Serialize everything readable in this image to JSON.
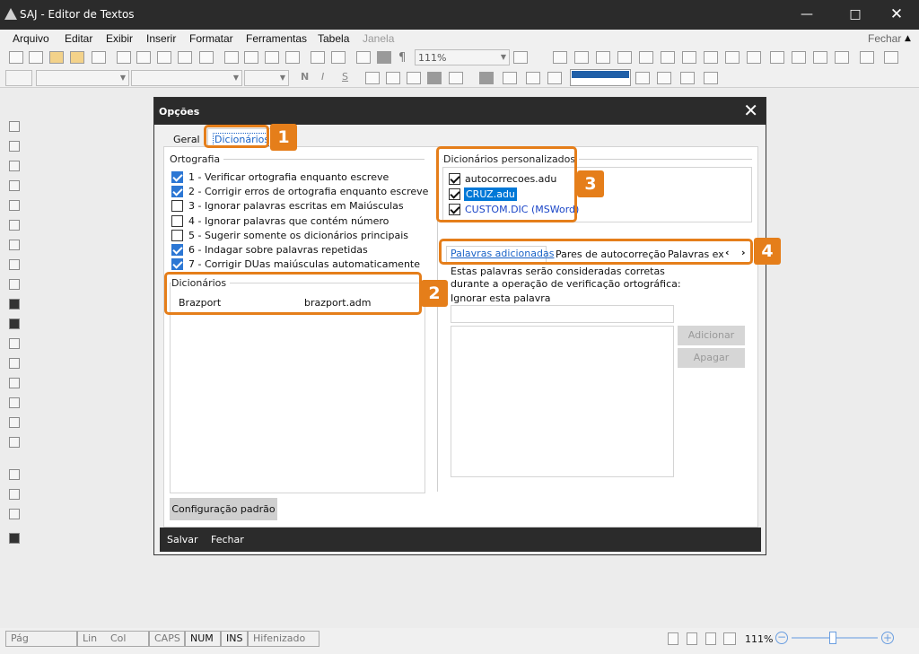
{
  "app": {
    "title": "SAJ - Editor de Textos"
  },
  "menu": {
    "items": [
      "Arquivo",
      "Editar",
      "Exibir",
      "Inserir",
      "Formatar",
      "Ferramentas",
      "Tabela",
      "Janela"
    ],
    "close_label": "Fechar"
  },
  "toolbar": {
    "zoom": "111%"
  },
  "dialog": {
    "title": "Opções",
    "tabs": [
      "Geral",
      "Dicionários"
    ],
    "ortografia": {
      "title": "Ortografia",
      "options": [
        {
          "label": "1 - Verificar ortografia enquanto escreve",
          "checked": true
        },
        {
          "label": "2 - Corrigir erros de ortografia enquanto escreve",
          "checked": true
        },
        {
          "label": "3 - Ignorar palavras escritas em Maiúsculas",
          "checked": false
        },
        {
          "label": "4 - Ignorar palavras que contém número",
          "checked": false
        },
        {
          "label": "5 - Sugerir somente os dicionários principais",
          "checked": false
        },
        {
          "label": "6 - Indagar sobre palavras repetidas",
          "checked": true
        },
        {
          "label": "7 - Corrigir DUas maiúsculas automaticamente",
          "checked": true
        }
      ]
    },
    "dicionarios": {
      "title": "Dicionários",
      "rows": [
        {
          "name": "Brazport",
          "file": "brazport.adm"
        }
      ]
    },
    "personalizados": {
      "title": "Dicionários personalizados",
      "items": [
        {
          "label": "autocorrecoes.adu",
          "checked": true
        },
        {
          "label": "CRUZ.adu",
          "checked": true,
          "selected": true
        },
        {
          "label": "CUSTOM.DIC (MSWord)",
          "checked": true,
          "link": true
        }
      ]
    },
    "subtabs": [
      "Palavras adicionadas",
      "Pares de autocorreção",
      "Palavras exc"
    ],
    "description": "Estas palavras serão consideradas corretas durante a operação de verificação ortográfica:",
    "ignore_label": "Ignorar esta palavra",
    "add_button": "Adicionar",
    "remove_button": "Apagar",
    "default_button": "Configuração padrão",
    "save_button": "Salvar",
    "close_button": "Fechar"
  },
  "callouts": [
    "1",
    "2",
    "3",
    "4"
  ],
  "statusbar": {
    "items": [
      "Pág",
      "Lin",
      "Col",
      "CAPS",
      "NUM",
      "INS",
      "Hifenizado"
    ],
    "zoom": "111%"
  },
  "colors": {
    "accent": "#e57e1a",
    "dark": "#2b2b2b",
    "check": "#2c77d4"
  }
}
